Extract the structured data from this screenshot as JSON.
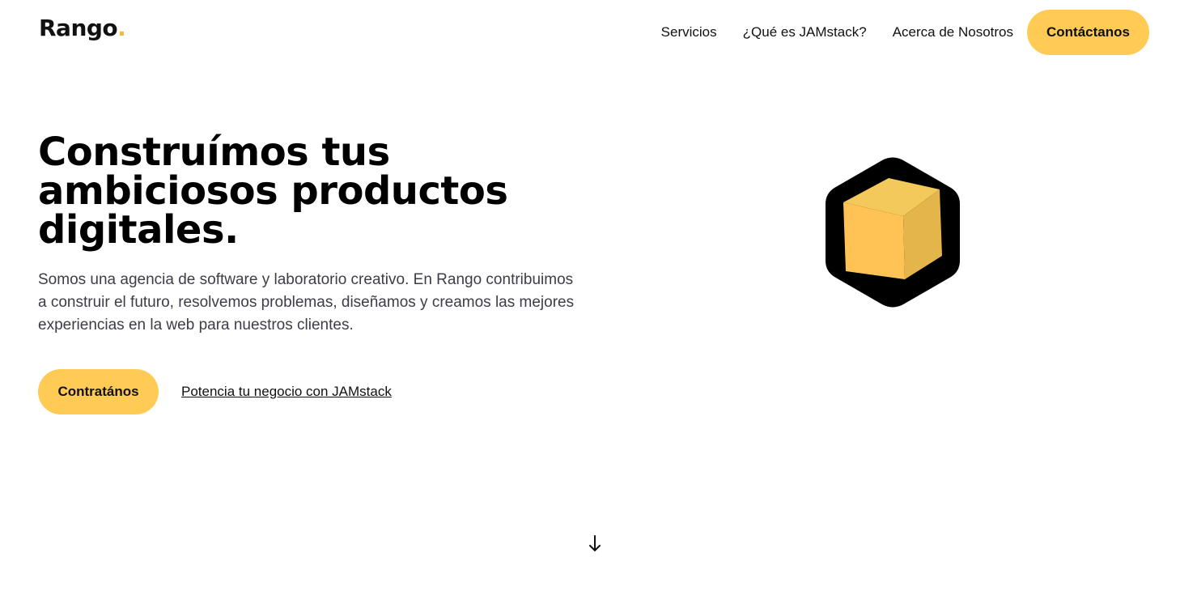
{
  "logo": {
    "text": "Rango",
    "dot": "."
  },
  "nav": {
    "items": [
      {
        "label": "Servicios"
      },
      {
        "label": "¿Qué es JAMstack?"
      },
      {
        "label": "Acerca de Nosotros"
      }
    ],
    "cta_label": "Contáctanos"
  },
  "hero": {
    "title_line1": "Construímos tus",
    "title_line2": "ambiciosos productos",
    "title_line3": "digitales.",
    "description": "Somos una agencia de software y laboratorio creativo. En Rango contribuimos a construir el futuro, resolvemos problemas, diseñamos y creamos las mejores experiencias en la web para nuestros clientes.",
    "primary_button": "Contratános",
    "secondary_link": "Potencia tu negocio con JAMstack",
    "graphic_icon": "hexagon-cube-icon"
  },
  "scroll_icon": "arrow-down-icon",
  "colors": {
    "accent": "#ffcb55",
    "logo_dot": "#f5b93a",
    "cube_top": "#f2c95a",
    "cube_left": "#ffc355",
    "cube_right": "#e4b54a",
    "text_muted": "#3d3d4a"
  }
}
